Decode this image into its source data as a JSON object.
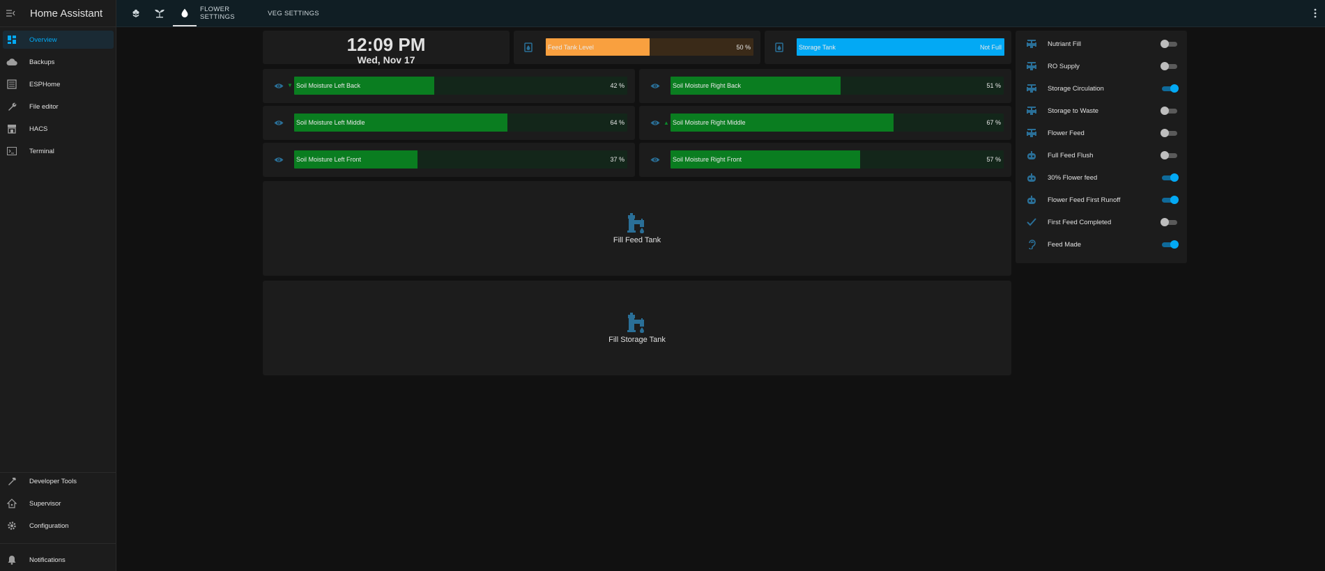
{
  "app": {
    "title": "Home Assistant"
  },
  "sidebar": {
    "items": [
      {
        "label": "Overview",
        "icon": "dashboard-icon"
      },
      {
        "label": "Backups",
        "icon": "cloud-icon"
      },
      {
        "label": "ESPHome",
        "icon": "chip-icon"
      },
      {
        "label": "File editor",
        "icon": "wrench-icon"
      },
      {
        "label": "HACS",
        "icon": "hacs-icon"
      },
      {
        "label": "Terminal",
        "icon": "console-icon"
      }
    ],
    "bottom": [
      {
        "label": "Developer Tools",
        "icon": "hammer-icon"
      },
      {
        "label": "Supervisor",
        "icon": "home-assistant-icon"
      },
      {
        "label": "Configuration",
        "icon": "gear-icon"
      },
      {
        "label": "Notifications",
        "icon": "bell-icon"
      }
    ]
  },
  "topbar": {
    "tabs": [
      {
        "icon": "flower-icon"
      },
      {
        "icon": "sprout-icon"
      },
      {
        "icon": "water-drop-icon",
        "active": true
      },
      {
        "label": "FLOWER SETTINGS"
      },
      {
        "label": "VEG SETTINGS"
      }
    ]
  },
  "clock": {
    "time": "12:09 PM",
    "date": "Wed, Nov 17"
  },
  "tanks": [
    {
      "name": "Feed Tank Level",
      "value": "50 %",
      "fill_fraction": 0.5,
      "color": "#f9a03f",
      "track": "#3a2a18"
    },
    {
      "name": "Storage Tank",
      "value": "Not Full",
      "fill_fraction": 1.0,
      "color": "#03a9f4",
      "track": "#0f3a50"
    }
  ],
  "moisture": [
    {
      "name": "Soil Moisture Left Back",
      "value": "42 %",
      "level": 42,
      "trend": "down"
    },
    {
      "name": "Soil Moisture Right Back",
      "value": "51 %",
      "level": 51,
      "trend": ""
    },
    {
      "name": "Soil Moisture Left Middle",
      "value": "64 %",
      "level": 64,
      "trend": ""
    },
    {
      "name": "Soil Moisture Right Middle",
      "value": "67 %",
      "level": 67,
      "trend": "up"
    },
    {
      "name": "Soil Moisture Left Front",
      "value": "37 %",
      "level": 37,
      "trend": ""
    },
    {
      "name": "Soil Moisture Right Front",
      "value": "57 %",
      "level": 57,
      "trend": ""
    }
  ],
  "colors": {
    "moisture_fill": "#0a7d20",
    "moisture_track": "#13261a",
    "accent": "#03a9f4",
    "icon_blue": "#2a6f97"
  },
  "buttons": [
    {
      "label": "Fill Feed Tank",
      "icon": "water-pump-icon"
    },
    {
      "label": "Fill Storage Tank",
      "icon": "water-pump-icon"
    }
  ],
  "toggles": [
    {
      "label": "Nutriant Fill",
      "on": false,
      "icon": "valve-icon"
    },
    {
      "label": "RO Supply",
      "on": false,
      "icon": "valve-icon"
    },
    {
      "label": "Storage Circulation",
      "on": true,
      "icon": "valve-icon"
    },
    {
      "label": "Storage to Waste",
      "on": false,
      "icon": "valve-icon"
    },
    {
      "label": "Flower Feed",
      "on": false,
      "icon": "valve-icon"
    },
    {
      "label": "Full Feed Flush",
      "on": false,
      "icon": "robot-icon"
    },
    {
      "label": "30% Flower feed",
      "on": true,
      "icon": "robot-icon"
    },
    {
      "label": "Flower Feed First Runoff",
      "on": true,
      "icon": "robot-icon"
    },
    {
      "label": "First Feed Completed",
      "on": false,
      "icon": "check-icon"
    },
    {
      "label": "Feed Made",
      "on": true,
      "icon": "ear-icon"
    }
  ]
}
